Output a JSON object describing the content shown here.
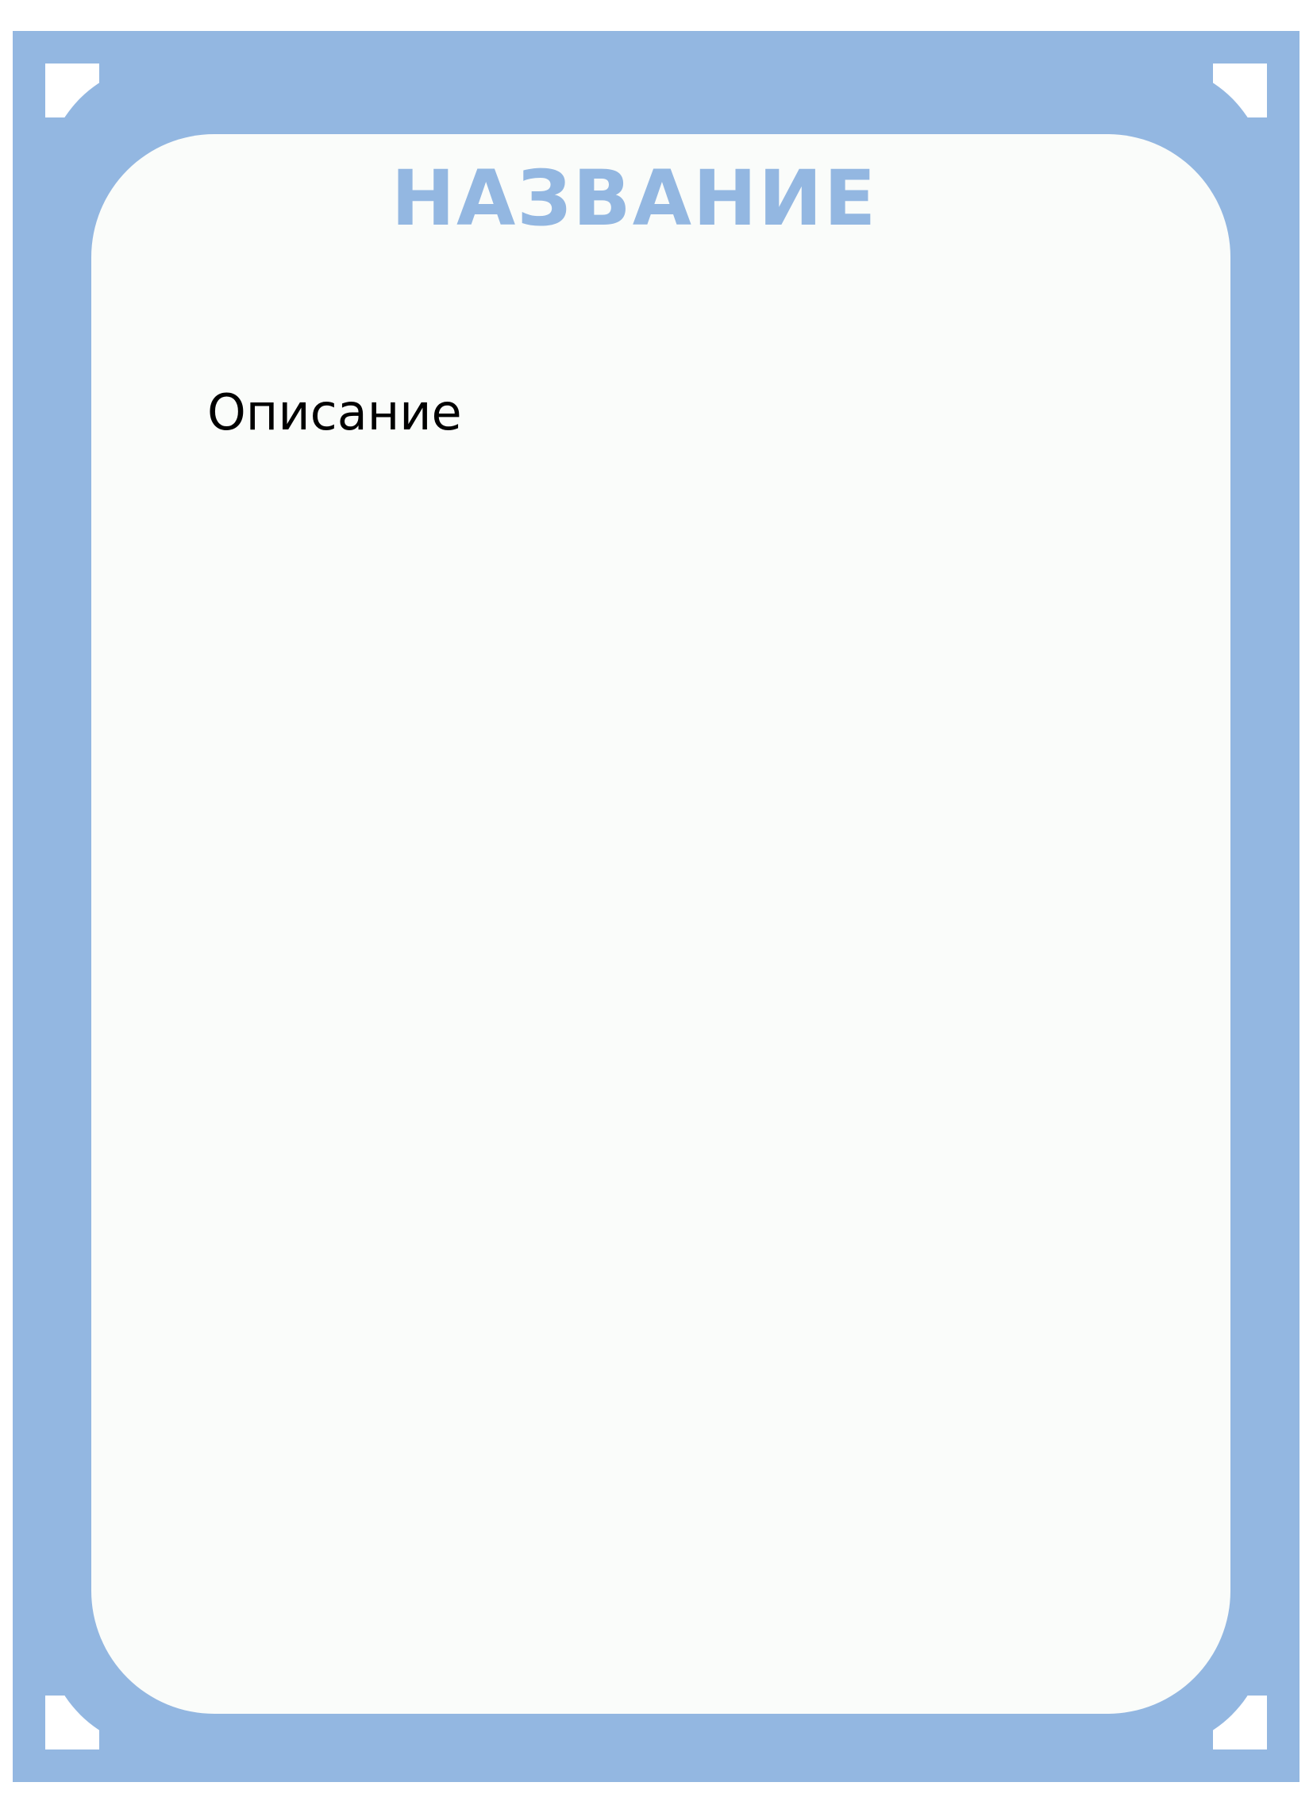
{
  "card": {
    "title": "НАЗВАНИЕ",
    "description": "Описание"
  },
  "colors": {
    "frame": "#93b7e1",
    "card_background": "#fafcfa",
    "title": "#93b7e1",
    "description": "#000000"
  }
}
